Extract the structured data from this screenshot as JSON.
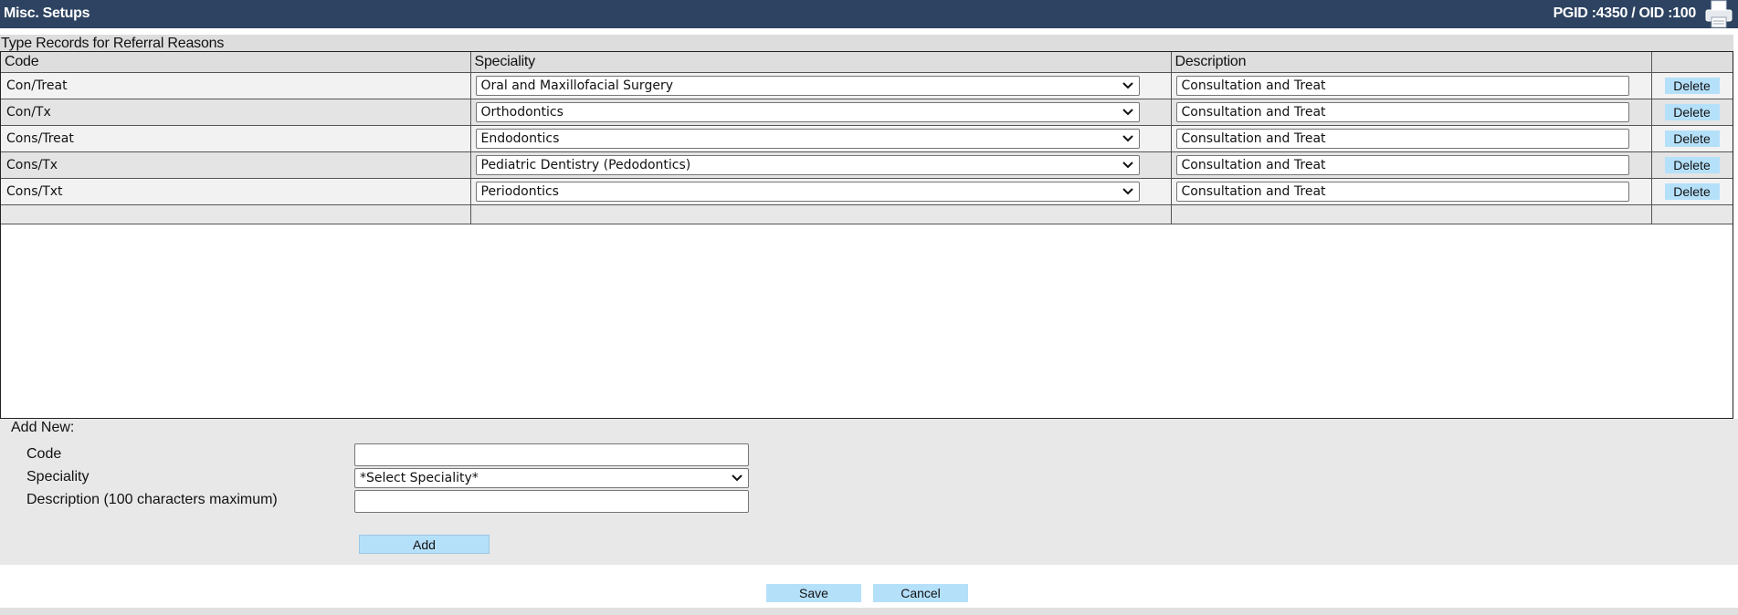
{
  "window": {
    "title": "Misc. Setups",
    "ids": "PGID :4350  /  OID :100",
    "print_icon": "printer-icon"
  },
  "grid": {
    "caption": "Type Records for Referral Reasons",
    "columns": {
      "code": "Code",
      "speciality": "Speciality",
      "description": "Description",
      "action": ""
    },
    "rows": [
      {
        "code": "Con/Treat",
        "speciality": "Oral and Maxillofacial Surgery",
        "description": "Consultation and Treat",
        "action": "Delete"
      },
      {
        "code": "Con/Tx",
        "speciality": "Orthodontics",
        "description": "Consultation and Treat",
        "action": "Delete"
      },
      {
        "code": "Cons/Treat",
        "speciality": "Endodontics",
        "description": "Consultation and Treat",
        "action": "Delete"
      },
      {
        "code": "Cons/Tx",
        "speciality": "Pediatric Dentistry (Pedodontics)",
        "description": "Consultation and Treat",
        "action": "Delete"
      },
      {
        "code": "Cons/Txt",
        "speciality": "Periodontics",
        "description": "Consultation and Treat",
        "action": "Delete"
      }
    ]
  },
  "add_new": {
    "heading": "Add New:",
    "code_label": "Code",
    "code_value": "",
    "speciality_label": "Speciality",
    "speciality_value": "*Select Speciality*",
    "description_label": "Description (100 characters maximum)",
    "description_value": "",
    "add_button": "Add"
  },
  "footer": {
    "save_button": "Save",
    "cancel_button": "Cancel"
  },
  "colors": {
    "titlebar": "#2d4361",
    "button": "#b5e0fa",
    "panel": "#e8e8e8"
  }
}
